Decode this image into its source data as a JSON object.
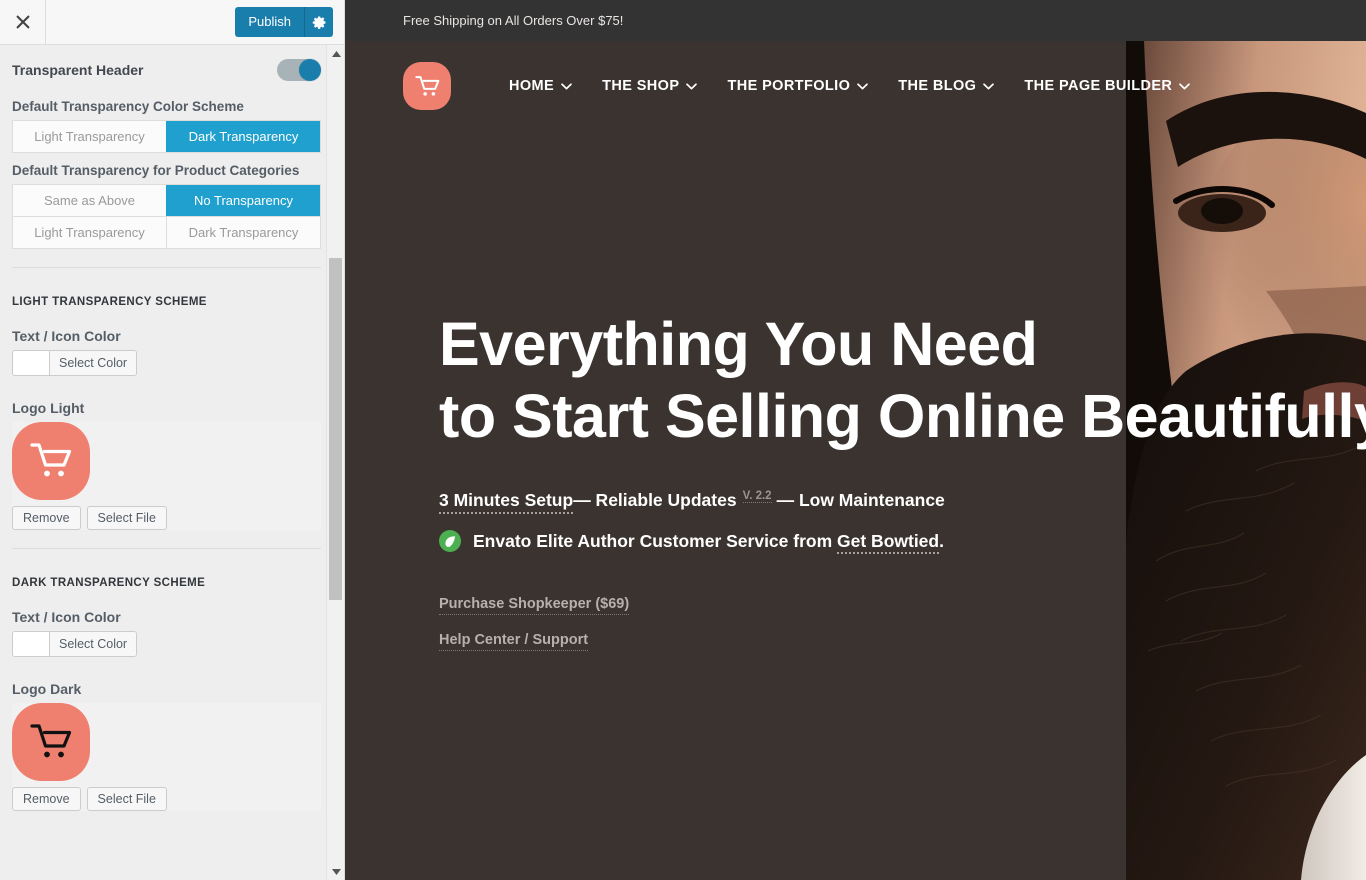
{
  "customizer": {
    "header": {
      "close_icon": "close-icon",
      "publish_label": "Publish",
      "gear_icon": "gear-icon"
    },
    "transparent_header": {
      "label": "Transparent Header",
      "toggle_state": "on"
    },
    "color_scheme": {
      "label": "Default Transparency Color Scheme",
      "options": [
        "Light Transparency",
        "Dark Transparency"
      ],
      "selected": "Dark Transparency"
    },
    "product_categories": {
      "label": "Default Transparency for Product Categories",
      "row1": [
        "Same as Above",
        "No Transparency"
      ],
      "row2": [
        "Light Transparency",
        "Dark Transparency"
      ],
      "selected": "No Transparency"
    },
    "light_scheme": {
      "title": "LIGHT TRANSPARENCY SCHEME",
      "text_icon_color_label": "Text / Icon Color",
      "select_color_label": "Select Color",
      "swatch_color": "#ffffff",
      "logo_label": "Logo Light",
      "logo_icon": "shopping-cart-icon",
      "logo_bg": "#ef8070",
      "logo_fg": "#ffffff",
      "remove_label": "Remove",
      "select_file_label": "Select File"
    },
    "dark_scheme": {
      "title": "DARK TRANSPARENCY SCHEME",
      "text_icon_color_label": "Text / Icon Color",
      "select_color_label": "Select Color",
      "swatch_color": "#ffffff",
      "logo_label": "Logo Dark",
      "logo_icon": "shopping-cart-icon",
      "logo_bg": "#ef8070",
      "logo_fg": "#111111",
      "remove_label": "Remove",
      "select_file_label": "Select File"
    },
    "accent_color": "#20a0ce",
    "publish_color": "#1a7ead"
  },
  "preview": {
    "announcement": "Free Shipping on All Orders Over $75!",
    "logo_icon": "shopping-cart-icon",
    "nav": [
      {
        "label": "HOME",
        "has_caret": true
      },
      {
        "label": "THE SHOP",
        "has_caret": true
      },
      {
        "label": "THE PORTFOLIO",
        "has_caret": true
      },
      {
        "label": "THE BLOG",
        "has_caret": true
      },
      {
        "label": "THE PAGE BUILDER",
        "has_caret": true
      }
    ],
    "hero": {
      "line1": "Everything You Need",
      "line2": "to Start Selling Online Beautifully",
      "sub_a": "3 Minutes Setup",
      "sub_b": " — Reliable Updates",
      "version": "V. 2.2",
      "sub_c": "— Low Maintenance",
      "sub2_before": "Envato Elite Author Customer Service from ",
      "sub2_link": "Get Bowtied",
      "sub2_after": ".",
      "envato_icon": "envato-leaf-icon",
      "links": [
        "Purchase Shopkeeper ($69)",
        "Help Center / Support"
      ]
    },
    "bg_color": "#3a332f",
    "topbar_color": "#333333",
    "brand_color": "#ef8070"
  }
}
